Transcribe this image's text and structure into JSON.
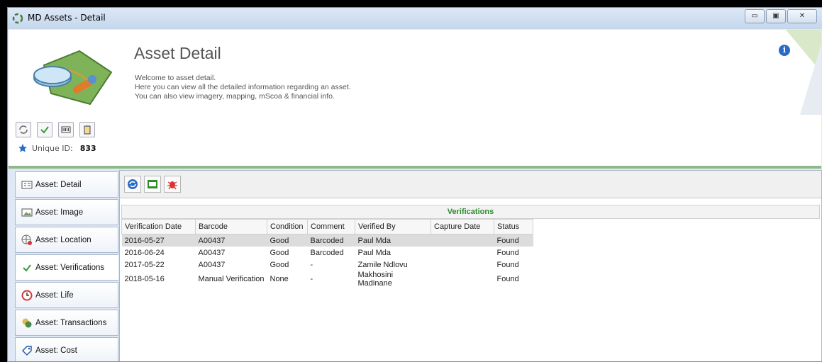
{
  "window": {
    "title": "MD Assets - Detail",
    "btn_minimize": "▭",
    "btn_maximize": "▣",
    "btn_close": "✕"
  },
  "header": {
    "title": "Asset Detail",
    "lines": [
      "Welcome to asset detail.",
      "Here you can view all the detailed information regarding an asset.",
      "You can also view imagery, mapping, mScoa & financial info."
    ],
    "info_glyph": "i",
    "unique_id_label": "Unique ID:",
    "unique_id_value": "833"
  },
  "header_icons": [
    "refresh-icon",
    "check-icon",
    "barcode-icon",
    "clipboard-icon"
  ],
  "sidebar": {
    "items": [
      {
        "label": "Asset: Detail",
        "icon": "detail-card-icon"
      },
      {
        "label": "Asset: Image",
        "icon": "image-icon"
      },
      {
        "label": "Asset: Location",
        "icon": "globe-pin-icon"
      },
      {
        "label": "Asset: Verifications",
        "icon": "check-icon"
      },
      {
        "label": "Asset: Life",
        "icon": "clock-icon"
      },
      {
        "label": "Asset: Transactions",
        "icon": "coins-icon"
      },
      {
        "label": "Asset: Cost",
        "icon": "tag-icon"
      }
    ],
    "active_index": 3
  },
  "content_toolbar": [
    "refresh-icon",
    "export-xls-icon",
    "bug-icon"
  ],
  "grid": {
    "title": "Verifications",
    "columns": [
      "Verification Date",
      "Barcode",
      "Condition",
      "Comment",
      "Verified By",
      "Capture Date",
      "Status"
    ],
    "rows": [
      [
        "2016-05-27",
        "A00437",
        "Good",
        "Barcoded",
        "Paul Mda",
        "",
        "Found"
      ],
      [
        "2016-06-24",
        "A00437",
        "Good",
        "Barcoded",
        "Paul Mda",
        "",
        "Found"
      ],
      [
        "2017-05-22",
        "A00437",
        "Good",
        "-",
        "Zamile Ndlovu",
        "",
        "Found"
      ],
      [
        "2018-05-16",
        "Manual Verification",
        "None",
        "-",
        "Makhosini Madinane",
        "",
        "Found"
      ]
    ],
    "selected_row": 0
  },
  "colors": {
    "accent_green": "#2e8b2e",
    "info_blue": "#2a6cc5",
    "divider_green": "#8fb98a"
  }
}
